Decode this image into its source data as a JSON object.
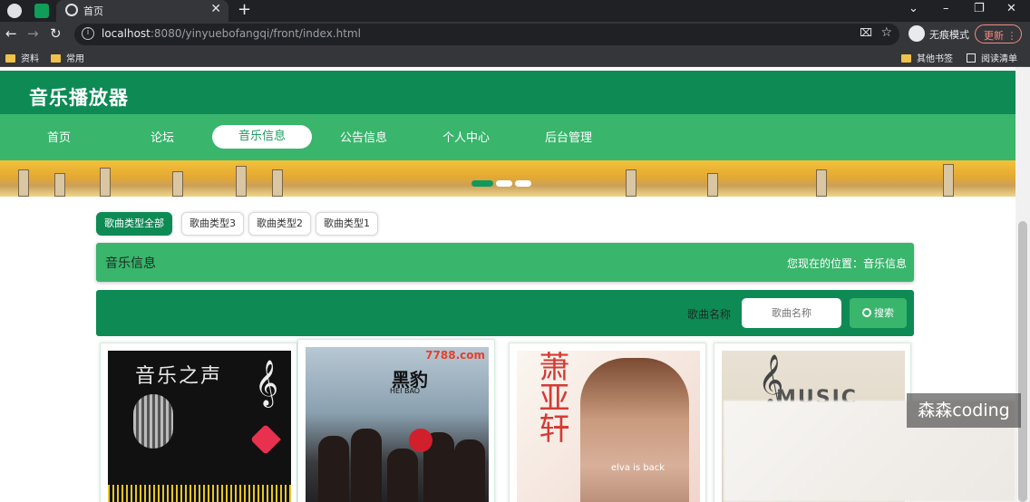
{
  "browser": {
    "tab_title": "首页",
    "new_tab_symbol": "+",
    "close_tab_symbol": "✕",
    "url_host": "localhost",
    "url_rest": ":8080/yinyuebofangqi/front/index.html",
    "incognito_label": "无痕模式",
    "update_label": "更新",
    "bookmarks": [
      "资料",
      "常用"
    ],
    "bookmarks_right": [
      "其他书签",
      "阅读清单"
    ]
  },
  "site": {
    "title": "音乐播放器",
    "nav": [
      "首页",
      "论坛",
      "音乐信息",
      "公告信息",
      "个人中心",
      "后台管理"
    ],
    "active_nav": "音乐信息"
  },
  "categories": [
    "歌曲类型全部",
    "歌曲类型3",
    "歌曲类型2",
    "歌曲类型1"
  ],
  "info_bar": {
    "title": "音乐信息",
    "location": "您现在的位置：音乐信息"
  },
  "search": {
    "label": "歌曲名称",
    "placeholder": "歌曲名称",
    "button": "搜索"
  },
  "covers": {
    "card1_text": "音乐之声",
    "card2_brand": "7788.com",
    "card2_logo": "黑豹",
    "card2_sub": "HEI BAO",
    "card3_text": "萧亚轩",
    "card3_tag": "elva is back",
    "card4_word": "MUSIC"
  },
  "watermark": "森森coding",
  "colors": {
    "header_dark_green": "#0e8a55",
    "nav_green": "#39b56c"
  }
}
